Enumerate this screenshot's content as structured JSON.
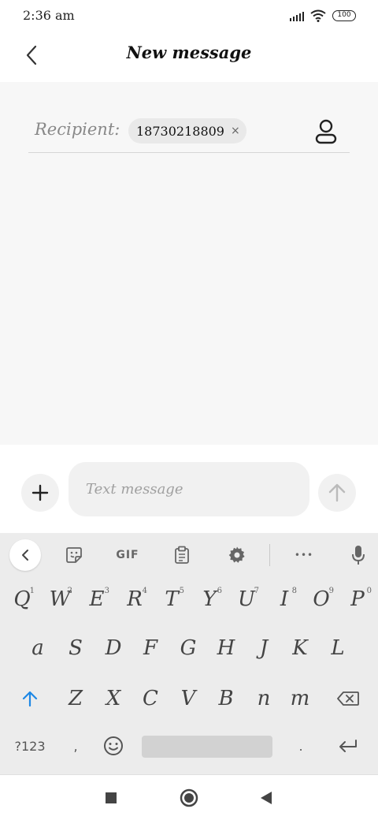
{
  "status_bar": {
    "time": "2:36 am",
    "battery": "100"
  },
  "header": {
    "title": "New message"
  },
  "recipient": {
    "label": "Recipient:",
    "chip_number": "18730218809",
    "chip_remove": "×"
  },
  "compose": {
    "placeholder": "Text message"
  },
  "keyboard": {
    "toolbar": {
      "gif_label": "GIF",
      "more_label": "•••"
    },
    "row1": [
      "Q",
      "W",
      "E",
      "R",
      "T",
      "Y",
      "U",
      "I",
      "O",
      "P"
    ],
    "row1_hints": [
      "1",
      "2",
      "3",
      "4",
      "5",
      "6",
      "7",
      "8",
      "9",
      "0"
    ],
    "row2": [
      "a",
      "S",
      "D",
      "F",
      "G",
      "H",
      "J",
      "K",
      "L"
    ],
    "row3": [
      "Z",
      "X",
      "C",
      "V",
      "B",
      "n",
      "m"
    ],
    "row4": {
      "symbols": "?123",
      "comma": ",",
      "period": "."
    }
  }
}
